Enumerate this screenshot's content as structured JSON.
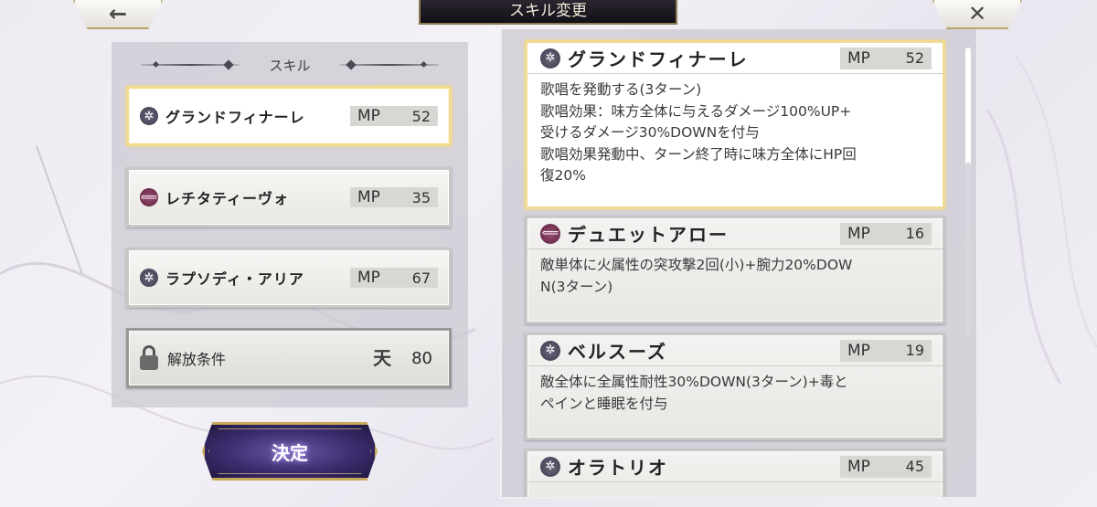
{
  "header": {
    "title": "スキル変更",
    "back_icon": "←",
    "close_icon": "✕"
  },
  "left_panel": {
    "heading": "スキル",
    "skills": [
      {
        "name": "グランドフィナーレ",
        "mp_label": "MP",
        "mp": "52",
        "icon": "star-icon",
        "selected": true
      },
      {
        "name": "レチタティーヴォ",
        "mp_label": "MP",
        "mp": "35",
        "icon": "arrow-icon",
        "selected": false
      },
      {
        "name": "ラプソディ・アリア",
        "mp_label": "MP",
        "mp": "67",
        "icon": "star-icon",
        "selected": false
      }
    ],
    "locked": {
      "label": "解放条件",
      "rank_icon": "天",
      "value": "80"
    },
    "confirm_label": "決定"
  },
  "right_panel": {
    "details": [
      {
        "name": "グランドフィナーレ",
        "mp_label": "MP",
        "mp": "52",
        "icon": "star-icon",
        "lines": [
          "歌唱を発動する(3ターン)",
          "歌唱効果：味方全体に与えるダメージ100%UP+",
          "受けるダメージ30%DOWNを付与",
          "歌唱効果発動中、ターン終了時に味方全体にHP回",
          "復20%"
        ]
      },
      {
        "name": "デュエットアロー",
        "mp_label": "MP",
        "mp": "16",
        "icon": "arrow-icon",
        "lines": [
          "敵単体に火属性の突攻撃2回(小)+腕力20%DOW",
          "N(3ターン)"
        ]
      },
      {
        "name": "ベルスーズ",
        "mp_label": "MP",
        "mp": "19",
        "icon": "star-icon",
        "lines": [
          "敵全体に全属性耐性30%DOWN(3ターン)+毒と",
          "ペインと睡眠を付与"
        ]
      },
      {
        "name": "オラトリオ",
        "mp_label": "MP",
        "mp": "45",
        "icon": "star-icon",
        "lines": []
      }
    ]
  },
  "colors": {
    "selected_border": "#f2dc91",
    "panel_bg": "#cecbd4",
    "confirm_bg": "#3c2c6e",
    "confirm_border": "#c8a85a"
  }
}
